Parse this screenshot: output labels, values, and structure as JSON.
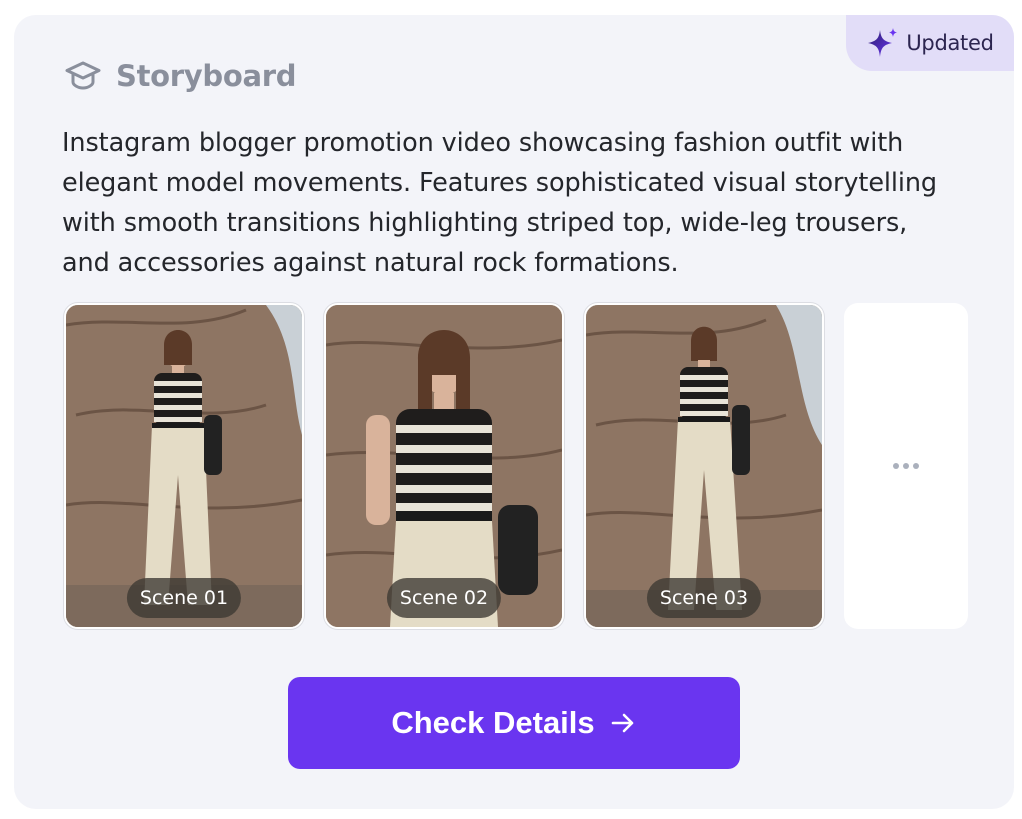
{
  "badge": {
    "label": "Updated",
    "icon": "sparkle-icon",
    "color": "#2c2550"
  },
  "header": {
    "icon": "graduation-cap-icon",
    "title": "Storyboard"
  },
  "description": "Instagram blogger promotion video showcasing fashion outfit with elegant model movements. Features sophisticated visual storytelling with smooth transitions highlighting striped top, wide-leg trousers, and accessories against natural rock formations.",
  "scenes": [
    {
      "label": "Scene 01"
    },
    {
      "label": "Scene 02"
    },
    {
      "label": "Scene 03"
    }
  ],
  "more": {
    "icon": "more-horizontal-icon"
  },
  "cta": {
    "label": "Check Details",
    "icon": "arrow-right-icon",
    "color": "#6a35f0"
  }
}
